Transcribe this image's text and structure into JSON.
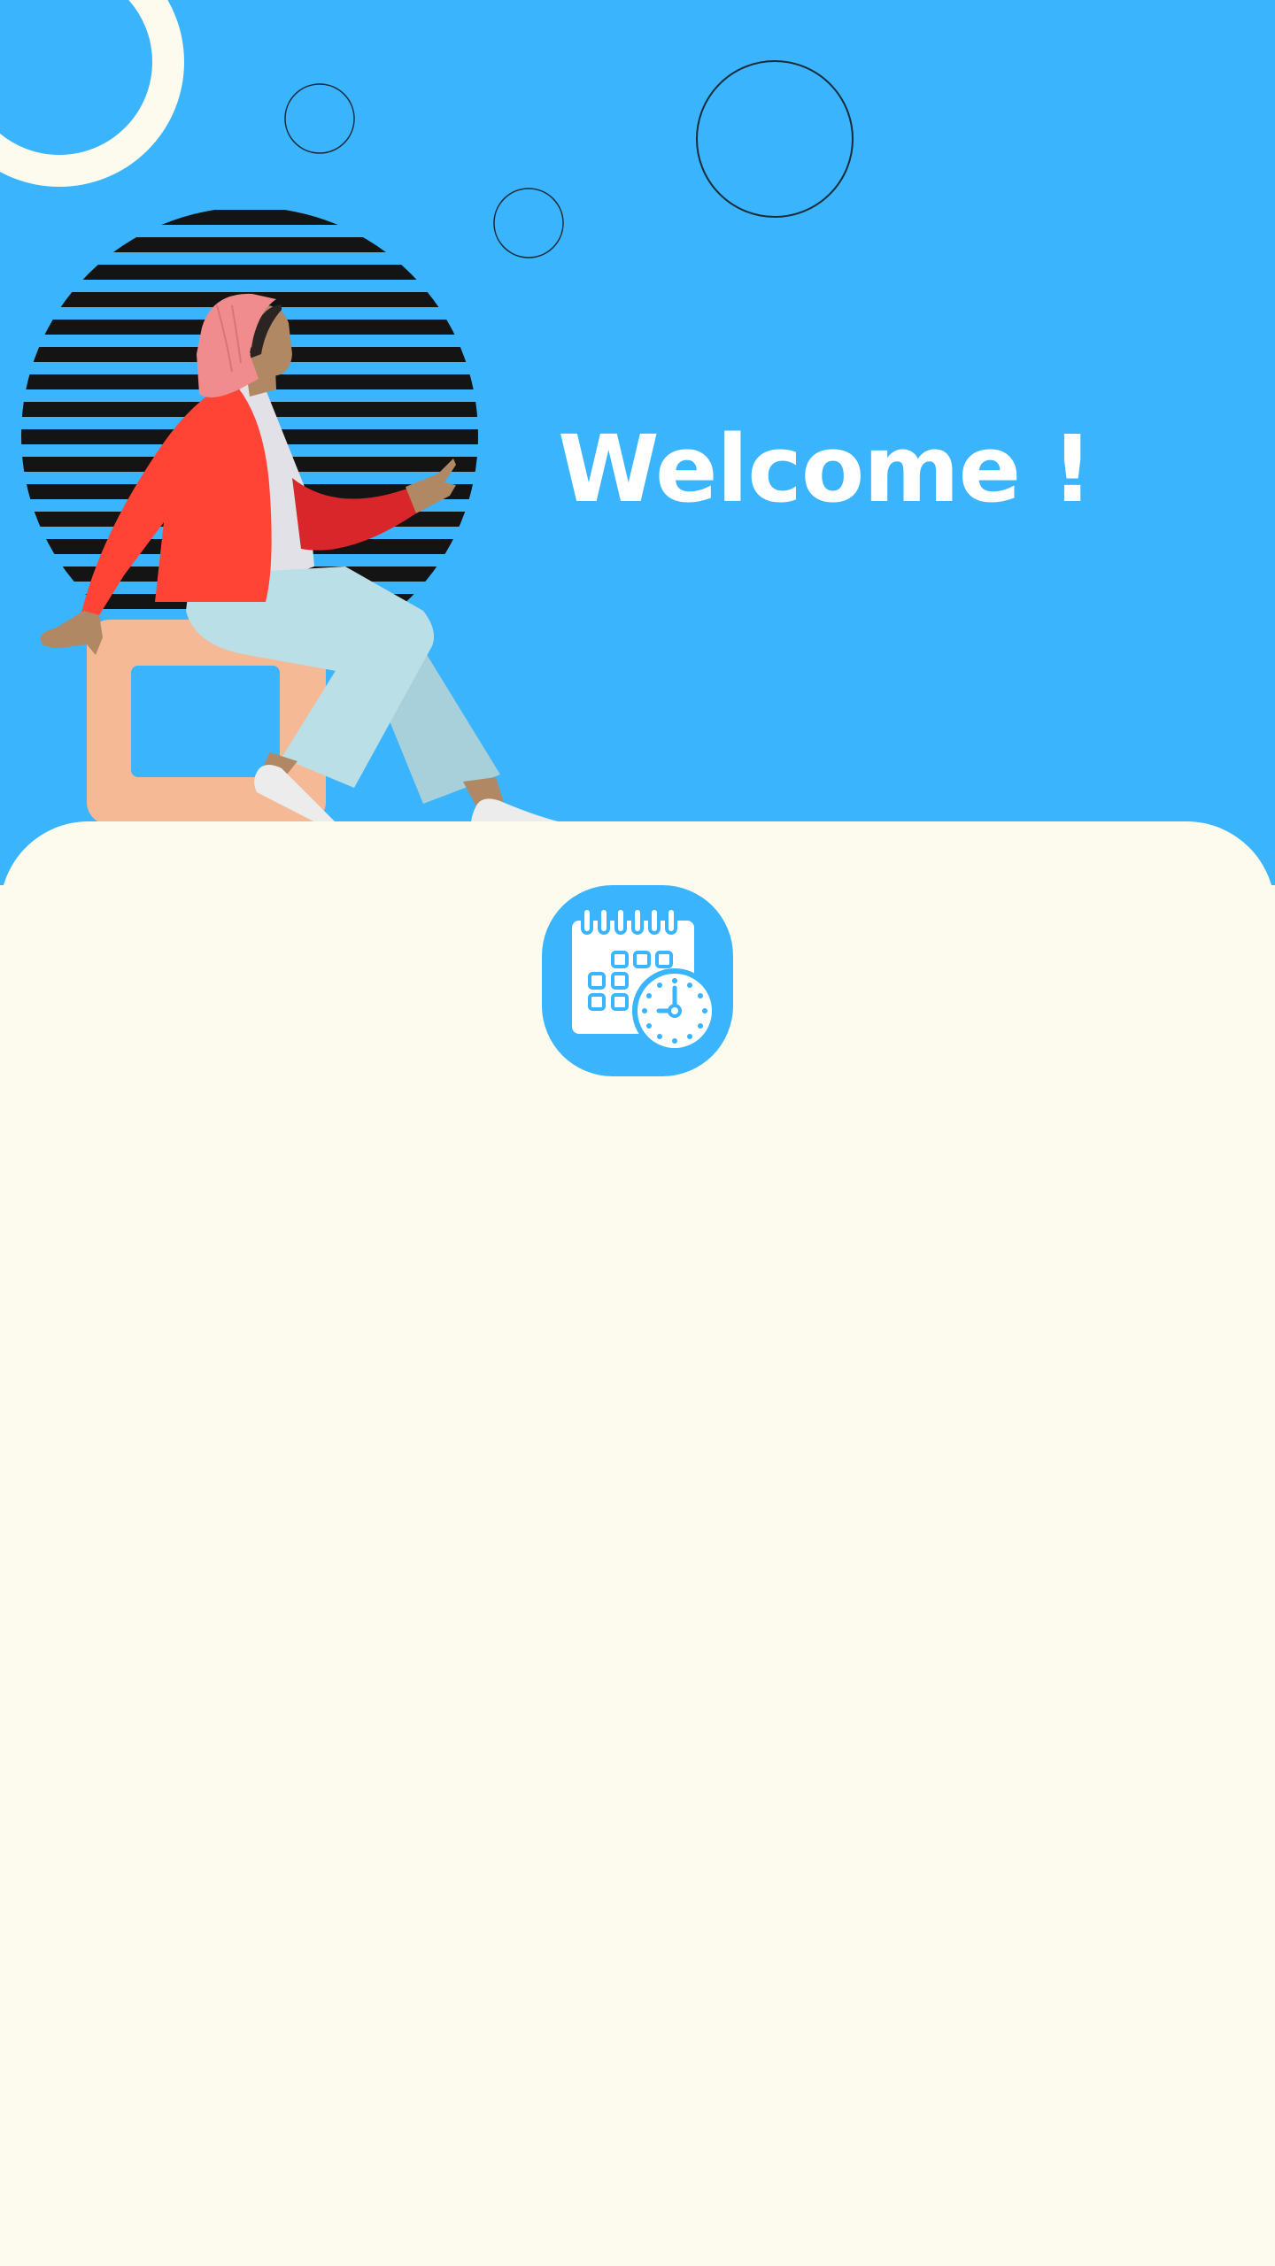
{
  "colors": {
    "hero_background": "#3AB4FD",
    "sheet_background": "#FDFBEE",
    "title_text": "#ffffff",
    "stripe_circle": "#141414",
    "jacket": "#FF4436",
    "hijab": "#F08B8E",
    "pants": "#BADFE6",
    "seat": "#F6B996",
    "skin": "#B08863"
  },
  "hero": {
    "title": "Welcome !",
    "illustration": "woman-sitting-on-block-pointing-illustration",
    "decorations": [
      "ring-top-left",
      "small-circle-outline",
      "small-circle-outline",
      "large-circle-outline",
      "striped-circle"
    ]
  },
  "app_logo": {
    "icon": "calendar-clock-icon"
  }
}
